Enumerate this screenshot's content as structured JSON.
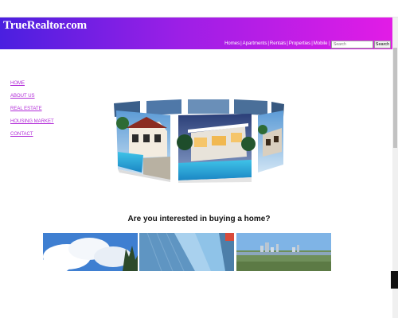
{
  "header": {
    "logo": "TrueRealtor.com",
    "nav": [
      "Homes",
      "Apartments",
      "Rentals",
      "Properties",
      "Mobile"
    ],
    "separator": "|",
    "search_placeholder": "Search",
    "search_button": "Search",
    "gradient": [
      "#4a1fe0",
      "#e21ce6"
    ]
  },
  "sidenav": [
    "HOME",
    "ABOUT US",
    "REAL ESTATE",
    "HOUSING MARKET",
    "CONTACT"
  ],
  "main": {
    "question": "Are you interested in buying a home?"
  },
  "colors": {
    "link": "#b22cd8"
  }
}
